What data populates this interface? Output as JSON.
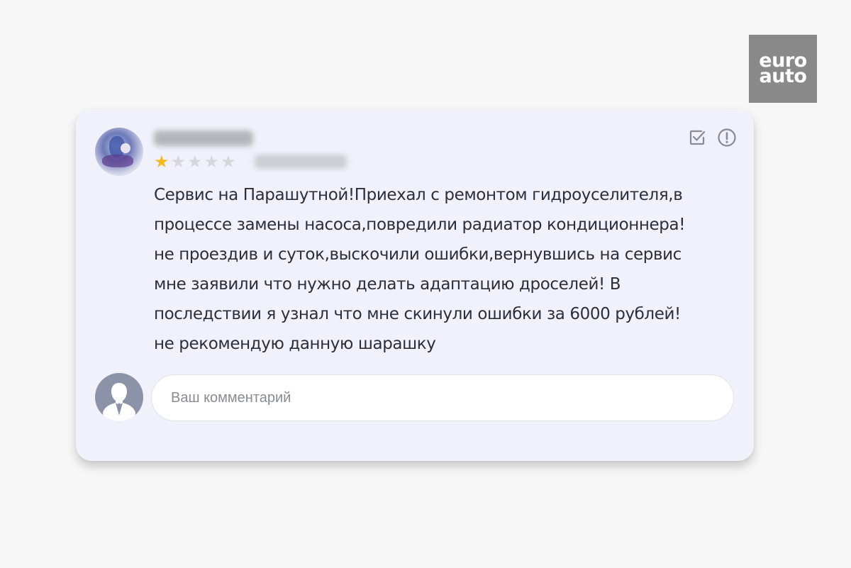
{
  "brand": {
    "logo_line1": "euro",
    "logo_line2": "auto",
    "logo_bg": "#898989"
  },
  "review": {
    "rating": 1,
    "rating_max": 5,
    "star_color": "#f5b920",
    "text": "Сервис на Парашутной!Приехал с ремонтом гидроуселителя,в\nпроцессе замены насоса,повредили радиатор кондиционнера!\nне проездив и суток,выскочили ошибки,вернувшись на сервис\nмне заявили что нужно делать адаптацию дроселей! В\nпоследствии я узнал что мне скинули ошибки за 6000 рублей!\nне рекомендую данную шарашку"
  },
  "actions": {
    "icons": [
      "check-square-icon",
      "info-circle-icon"
    ]
  },
  "comment": {
    "placeholder": "Ваш комментарий"
  }
}
